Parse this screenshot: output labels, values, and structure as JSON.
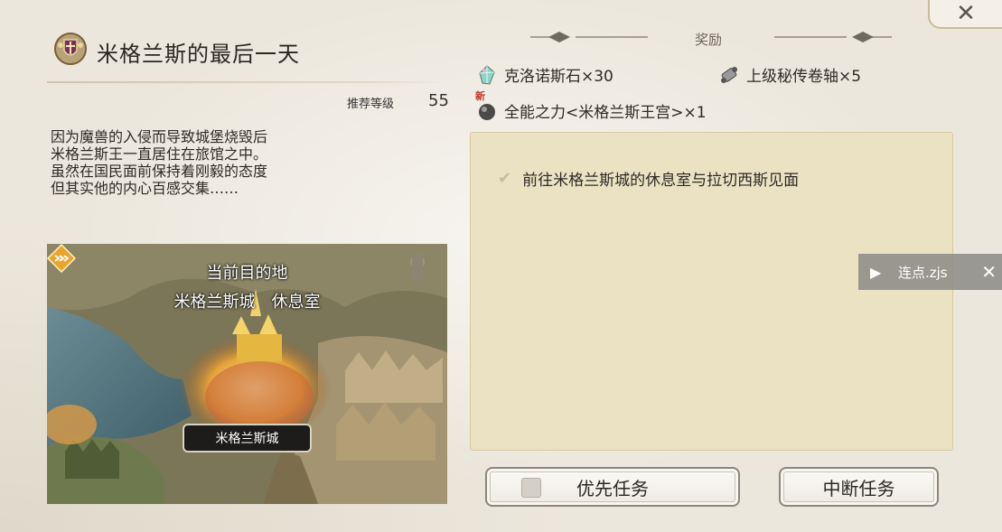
{
  "quest": {
    "title": "米格兰斯的最后一天",
    "emblem_icon": "kingdom-crest-icon",
    "recommended_level_label": "推荐等级",
    "recommended_level": "55",
    "description": [
      "因为魔兽的入侵而导致城堡烧毁后",
      "米格兰斯王一直居住在旅馆之中。",
      "虽然在国民面前保持着刚毅的态度",
      "但其实他的内心百感交集……"
    ]
  },
  "map": {
    "destination_title": "当前目的地",
    "destination": "米格兰斯城　休息室",
    "city_label": "米格兰斯城"
  },
  "rewards": {
    "title": "奖励",
    "items": [
      {
        "icon": "chronos-stone-icon",
        "label": "克洛诺斯石×30"
      },
      {
        "icon": "scroll-icon",
        "label": "上级秘传卷轴×5"
      },
      {
        "icon": "orb-icon",
        "label": "全能之力<米格兰斯王宫>×1",
        "badge": "新"
      }
    ]
  },
  "objectives": [
    {
      "text": "前往米格兰斯城的休息室与拉切西斯见面"
    }
  ],
  "overlay": {
    "label": "连点.zjs"
  },
  "buttons": {
    "priority": "优先任务",
    "abort": "中断任务"
  },
  "close_icon": "close-icon",
  "colors": {
    "background": "#ece7dc",
    "objective_panel": "#ebe2c4",
    "accent_gold": "#d9a640"
  }
}
